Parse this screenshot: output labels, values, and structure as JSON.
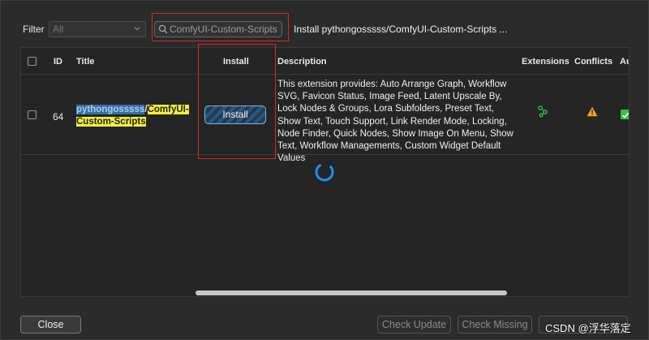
{
  "filter": {
    "label": "Filter",
    "selected": "All",
    "search_value": "ComfyUI-Custom-Scripts",
    "status": "Install pythongosssss/ComfyUI-Custom-Scripts ..."
  },
  "table": {
    "headers": {
      "id": "ID",
      "title": "Title",
      "install": "Install",
      "description": "Description",
      "extensions": "Extensions",
      "conflicts": "Conflicts",
      "autoupdate": "Au"
    },
    "rows": [
      {
        "id": "64",
        "title_author": "pythongosssss",
        "title_slash": "/",
        "title_name_part1": "ComfyUI-",
        "title_name_part2": "Custom-Scripts",
        "install_label": "Install",
        "description": "This extension provides: Auto Arrange Graph, Workflow SVG, Favicon Status, Image Feed, Latent Upscale By, Lock Nodes & Groups, Lora Subfolders, Preset Text, Show Text, Touch Support, Link Render Mode, Locking, Node Finder, Quick Nodes, Show Image On Menu, Show Text, Workflow Managements, Custom Widget Default Values",
        "extensions_icon": "extension-link-icon",
        "conflicts_icon": "warning-icon",
        "autoupdate_icon": "green-check-icon"
      }
    ]
  },
  "footer": {
    "close_label": "Close",
    "check_update_label": "Check Update",
    "check_missing_label": "Check Missing",
    "third_label": ""
  },
  "watermark": "CSDN @浮华落定",
  "colors": {
    "highlight_box": "#d42a2a",
    "title_highlight": "#f3ef38",
    "install_button": "#2f5678",
    "warning": "#f5a623",
    "success": "#35c24a",
    "spinner": "#1e90ff"
  }
}
